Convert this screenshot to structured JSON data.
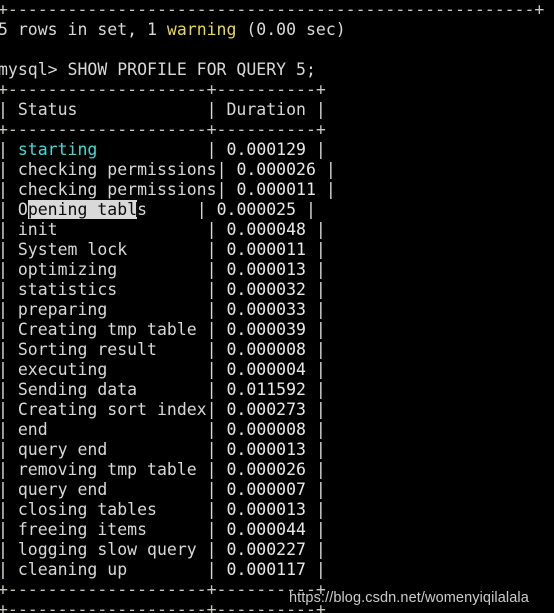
{
  "terminal": {
    "app": "mysql-client-terminal",
    "background_color": "#000000",
    "foreground_color": "#d8d8d8",
    "warning_color": "#e8d84a",
    "highlight_color": "#46d9d9",
    "selection_bg_color": "#d9d9d9",
    "selection_fg_color": "#0b0b0b"
  },
  "scrollback": {
    "top_rule": "+-----------------------------------------------------+",
    "result_line": {
      "prefix": "5 rows in set, 1 ",
      "warning_word": "warning",
      "suffix": " (0.00 sec)"
    },
    "prompt": "mysql> ",
    "command": "SHOW PROFILE FOR QUERY 5;"
  },
  "profile_table": {
    "border_top": "+--------------------+----------+",
    "border_header": "+--------------------+----------+",
    "border_bottom": "+--------------------+----------+",
    "columns": [
      "Status",
      "Duration"
    ],
    "header_row": "| Status             | Duration |",
    "rows": [
      {
        "status": "starting",
        "duration": "0.000129",
        "colored": true,
        "selected": false
      },
      {
        "status": "checking permissions",
        "duration": "0.000026",
        "colored": false,
        "selected": false
      },
      {
        "status": "checking permissions",
        "duration": "0.000011",
        "colored": false,
        "selected": false
      },
      {
        "status": "Opening tables",
        "duration": "0.000025",
        "colored": false,
        "selected": true,
        "selection": {
          "before": "O",
          "inside": "pening tabl",
          "after": "s",
          "caret_after_inside": true
        }
      },
      {
        "status": "init",
        "duration": "0.000048",
        "colored": false,
        "selected": false
      },
      {
        "status": "System lock",
        "duration": "0.000011",
        "colored": false,
        "selected": false
      },
      {
        "status": "optimizing",
        "duration": "0.000013",
        "colored": false,
        "selected": false
      },
      {
        "status": "statistics",
        "duration": "0.000032",
        "colored": false,
        "selected": false
      },
      {
        "status": "preparing",
        "duration": "0.000033",
        "colored": false,
        "selected": false
      },
      {
        "status": "Creating tmp table",
        "duration": "0.000039",
        "colored": false,
        "selected": false
      },
      {
        "status": "Sorting result",
        "duration": "0.000008",
        "colored": false,
        "selected": false
      },
      {
        "status": "executing",
        "duration": "0.000004",
        "colored": false,
        "selected": false
      },
      {
        "status": "Sending data",
        "duration": "0.011592",
        "colored": false,
        "selected": false
      },
      {
        "status": "Creating sort index",
        "duration": "0.000273",
        "colored": false,
        "selected": false
      },
      {
        "status": "end",
        "duration": "0.000008",
        "colored": false,
        "selected": false
      },
      {
        "status": "query end",
        "duration": "0.000013",
        "colored": false,
        "selected": false
      },
      {
        "status": "removing tmp table",
        "duration": "0.000026",
        "colored": false,
        "selected": false
      },
      {
        "status": "query end",
        "duration": "0.000007",
        "colored": false,
        "selected": false
      },
      {
        "status": "closing tables",
        "duration": "0.000013",
        "colored": false,
        "selected": false
      },
      {
        "status": "freeing items",
        "duration": "0.000044",
        "colored": false,
        "selected": false
      },
      {
        "status": "logging slow query",
        "duration": "0.000227",
        "colored": false,
        "selected": false
      },
      {
        "status": "cleaning up",
        "duration": "0.000117",
        "colored": false,
        "selected": false
      }
    ]
  },
  "watermark": {
    "text": "https://blog.csdn.net/womenyiqilalala"
  }
}
